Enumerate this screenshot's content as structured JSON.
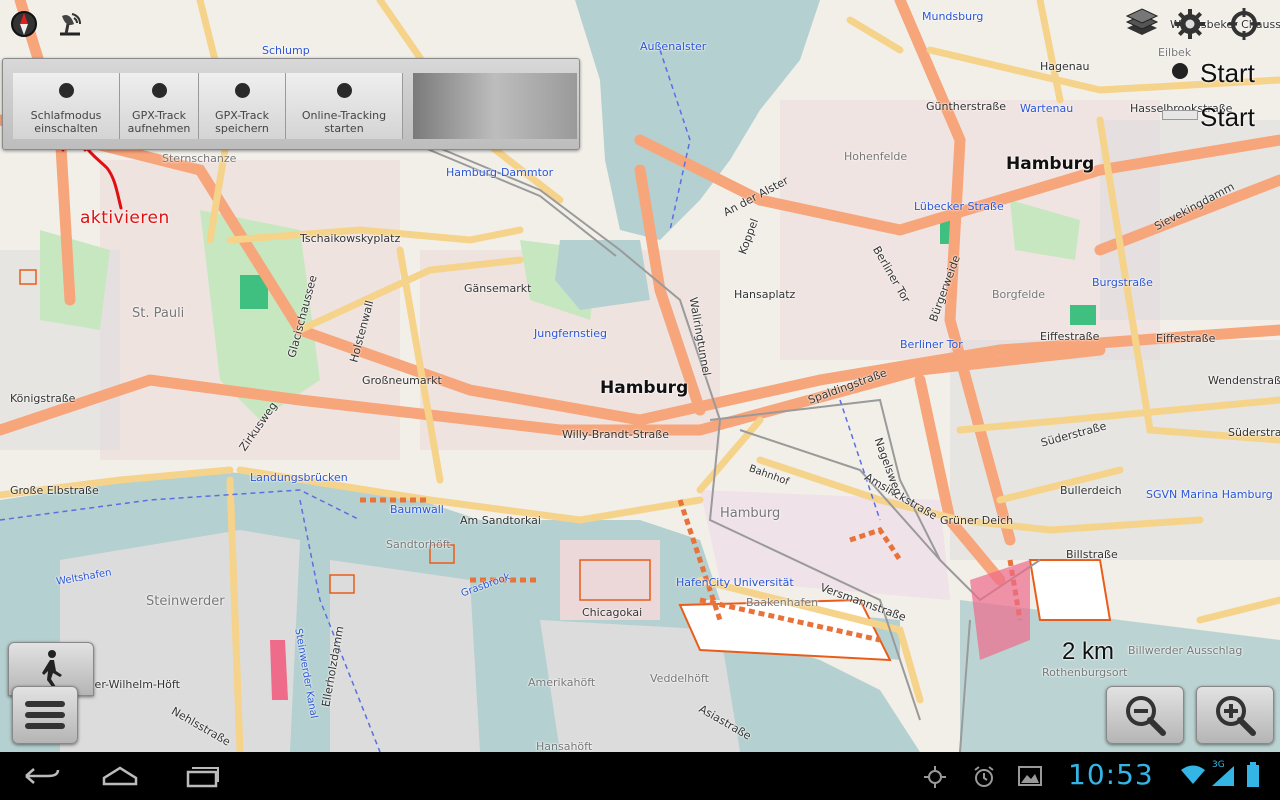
{
  "map": {
    "labels": {
      "schlump": "Schlump",
      "aussenalster": "Außenalster",
      "mundsburg": "Mundsburg",
      "eilbek": "Eilbek",
      "wandsbeker_chaussee": "Wandsbeker Chaussee",
      "hagenau": "Hagenau",
      "guentherstrasse": "Güntherstraße",
      "wartenau": "Wartenau",
      "hasselbrookstrasse": "Hasselbrookstraße",
      "sternschanze": "Sternschanze",
      "hamburg_dammtor": "Hamburg-Dammtor",
      "hohenfelde": "Hohenfelde",
      "hamburg_ne": "Hamburg",
      "an_der_alster": "An der Alster",
      "luebecker_strasse": "Lübecker Straße",
      "sievekingdamm": "Sievekingdamm",
      "tschaikowskyplatz": "Tschaikowskyplatz",
      "koppel": "Koppel",
      "berliner_tor_street": "Berliner Tor",
      "buergerweide": "Bürgerweide",
      "borgfelde": "Borgfelde",
      "burgstrasse": "Burgstraße",
      "gaensemarkt": "Gänsemarkt",
      "hansaplatz": "Hansaplatz",
      "st_pauli": "St. Pauli",
      "glacischaussee": "Glacischaussee",
      "holstenwall": "Holstenwall",
      "jungfernstieg": "Jungfernstieg",
      "wallringtunnel": "Wallringtunnel",
      "berliner_tor": "Berliner Tor",
      "eiffestrasse_1": "Eiffestraße",
      "eiffestrasse_2": "Eiffestraße",
      "grossneumarkt": "Großneumarkt",
      "hamburg_center": "Hamburg",
      "wendenstrasse": "Wendenstraße",
      "koenigstrasse": "Königstraße",
      "zirkusweg": "Zirkusweg",
      "spaldingstrasse": "Spaldingstraße",
      "willy_brandt": "Willy-Brandt-Straße",
      "suederstrasse_1": "Süderstraße",
      "suederstrasse_2": "Süderstraße",
      "landungsbruecken": "Landungsbrücken",
      "grosse_elbstrasse": "Große Elbstraße",
      "baumwall": "Baumwall",
      "am_sandtorkai": "Am Sandtorkai",
      "hamburg_hafen": "Hamburg",
      "amsinckstrasse": "Amsinckstraße",
      "nagelsweg": "Nagelsweg",
      "grüner_deich": "Grüner Deich",
      "bullerdeich": "Bullerdeich",
      "sgvn": "SGVN Marina Hamburg",
      "sandtorhoeft": "Sandtorhöft",
      "billstrasse": "Billstraße",
      "hafencity_uni": "HafenCity Universität",
      "steinwerder": "Steinwerder",
      "chicagokai": "Chicagokai",
      "baakenhafen": "Baakenhafen",
      "versmannstrasse": "Versmannstraße",
      "kaiser_wilhelm": "Kaiser-Wilhelm-Höft",
      "ellerholzdamm": "Ellerholzdamm",
      "steinwerder_kanal": "Steinwerder Kanal",
      "amerikahoeft": "Amerikahöft",
      "veddelhoeft": "Veddelhöft",
      "billwerder": "Billwerder Ausschlag",
      "rothenburgsort": "Rothenburgsort",
      "nehlsstrasse": "Nehlsstraße",
      "asiastrasse": "Asiastraße",
      "hansahoeft": "Hansahöft",
      "weltshafen": "Weltshafen",
      "bahnhof": "Bahnhof",
      "grasbrook": "Grasbrook"
    },
    "start_label_1": "Start",
    "start_label_2": "Start",
    "scale_label": "2 km",
    "annotation": "aktivieren"
  },
  "quick_panel": {
    "buttons": [
      {
        "label": "Schlafmodus\neinschalten"
      },
      {
        "label": "GPX-Track\naufnehmen"
      },
      {
        "label": "GPX-Track\nspeichern"
      },
      {
        "label": "Online-Tracking\nstarten"
      }
    ]
  },
  "icons": {
    "compass": "compass-icon",
    "gps_status": "gps-status-icon",
    "layers": "layers-icon",
    "settings": "gear-icon",
    "locate": "crosshair-icon",
    "walk_mode": "walking-person-icon",
    "menu": "menu-icon",
    "zoom_out": "zoom-out-icon",
    "zoom_in": "zoom-in-icon"
  },
  "status_bar": {
    "time": "10:53",
    "network": "3G"
  },
  "colors": {
    "clock": "#33b5e5",
    "road_major": "#f7a57a",
    "road_secondary": "#f6d38a",
    "water": "#b5d0d0",
    "annotation": "#e01010"
  }
}
